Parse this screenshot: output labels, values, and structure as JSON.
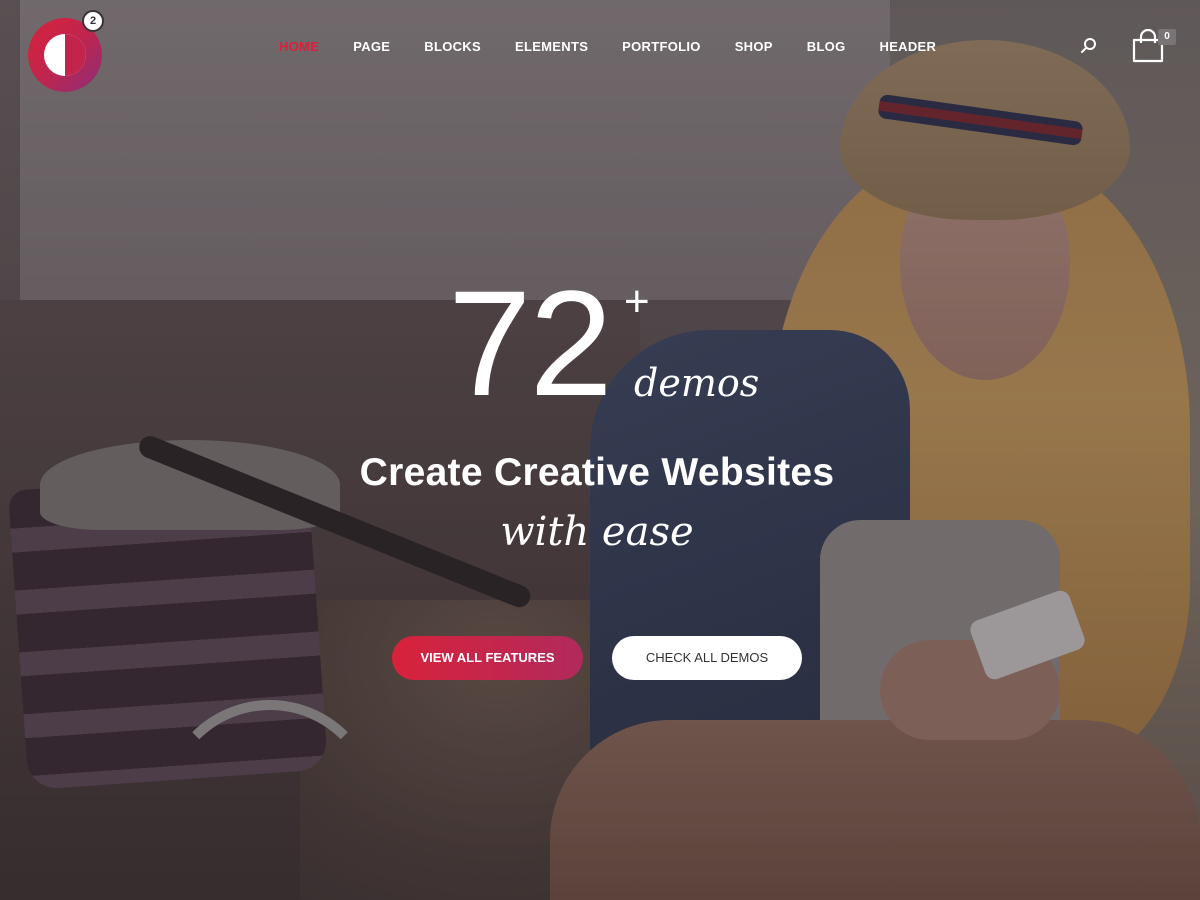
{
  "logo": {
    "badge": "2"
  },
  "nav": {
    "items": [
      {
        "label": "HOME",
        "active": true
      },
      {
        "label": "PAGE"
      },
      {
        "label": "BLOCKS"
      },
      {
        "label": "ELEMENTS"
      },
      {
        "label": "PORTFOLIO"
      },
      {
        "label": "SHOP"
      },
      {
        "label": "BLOG"
      },
      {
        "label": "HEADER"
      }
    ]
  },
  "header": {
    "search_icon": "search-icon",
    "cart_icon": "shopping-bag-icon",
    "cart_count": "0"
  },
  "hero": {
    "number": "72",
    "plus": "+",
    "demos": "demos",
    "title": "Create Creative Websites",
    "subtitle": "with ease",
    "primary_button": "VIEW ALL FEATURES",
    "secondary_button": "CHECK ALL DEMOS"
  },
  "colors": {
    "accent": "#d8223b",
    "accent_end": "#b12a5c",
    "text_on_dark": "#ffffff"
  }
}
